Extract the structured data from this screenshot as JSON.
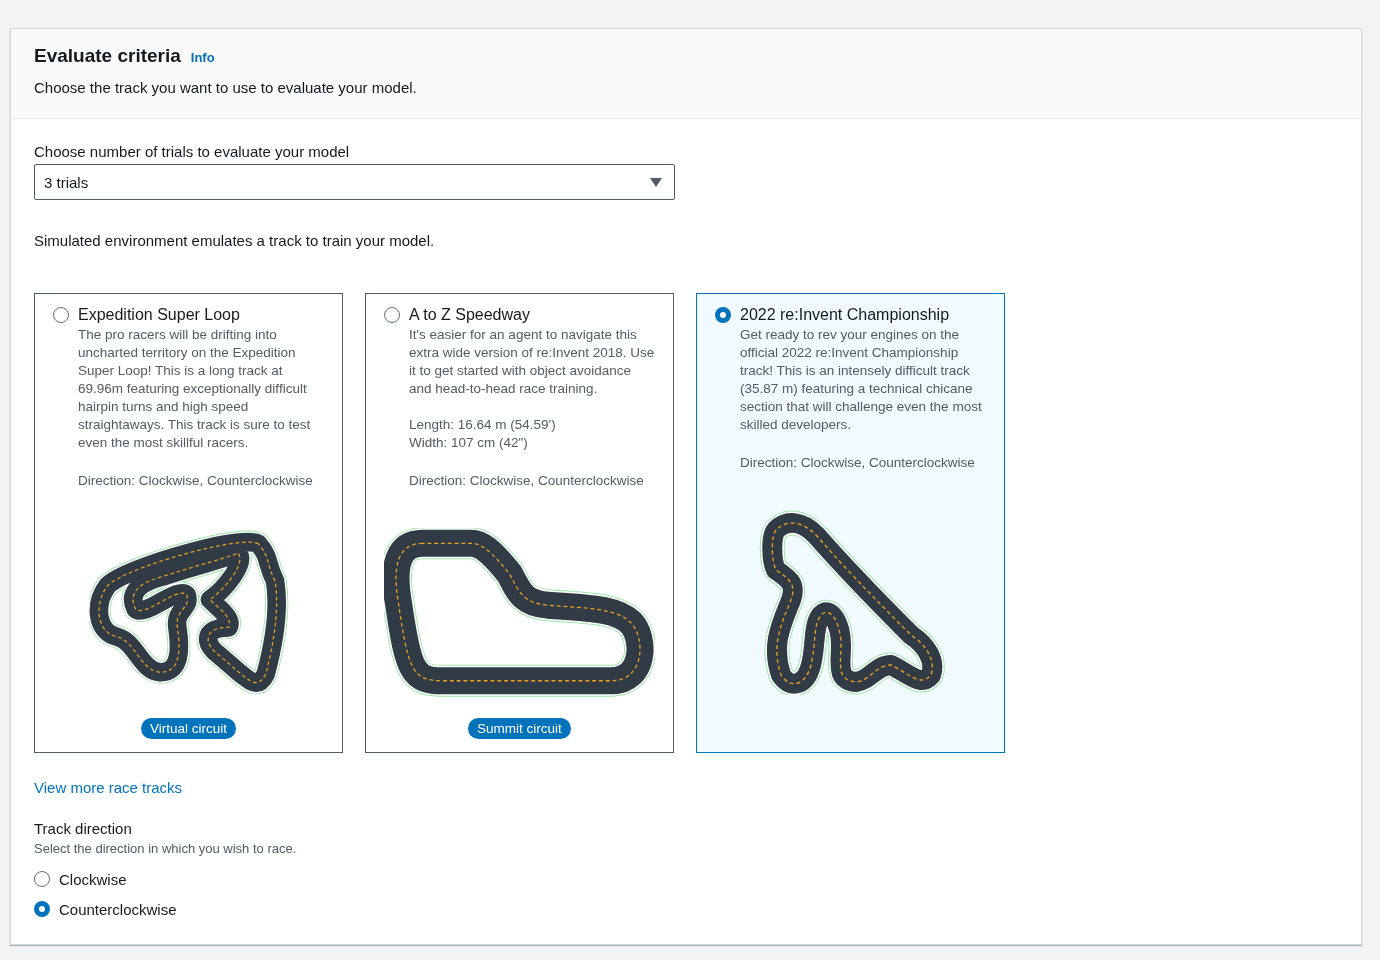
{
  "header": {
    "title": "Evaluate criteria",
    "info_link": "Info",
    "description": "Choose the track you want to use to evaluate your model."
  },
  "trials": {
    "label": "Choose number of trials to evaluate your model",
    "value": "3 trials"
  },
  "environment_note": "Simulated environment emulates a track to train your model.",
  "tracks": [
    {
      "kind": "loop",
      "name": "Expedition Super Loop",
      "selected": false,
      "description": "The pro racers will be drifting into uncharted territory on the Expedition Super Loop! This is a long track at 69.96m featuring exceptionally difficult hairpin turns and high speed straightaways. This track is sure to test even the most skillful racers.",
      "direction": "Direction: Clockwise, Counterclockwise",
      "badge": "Virtual circuit"
    },
    {
      "kind": "speedway",
      "name": "A to Z Speedway",
      "selected": false,
      "description": "It's easier for an agent to navigate this extra wide version of re:Invent 2018. Use it to get started with object avoidance and head-to-head race training.",
      "specs": [
        "Length: 16.64 m (54.59')",
        "Width: 107 cm (42\")"
      ],
      "direction": "Direction: Clockwise, Counterclockwise",
      "badge": "Summit circuit"
    },
    {
      "kind": "championship",
      "name": "2022 re:Invent Championship",
      "selected": true,
      "description": "Get ready to rev your engines on the official 2022 re:Invent Championship track! This is an intensely difficult track (35.87 m) featuring a technical chicane section that will challenge even the most skilled developers.",
      "direction": "Direction: Clockwise, Counterclockwise"
    }
  ],
  "more_link": "View more race tracks",
  "direction": {
    "label": "Track direction",
    "description": "Select the direction in which you wish to race.",
    "options": [
      {
        "label": "Clockwise",
        "selected": false
      },
      {
        "label": "Counterclockwise",
        "selected": true
      }
    ]
  }
}
